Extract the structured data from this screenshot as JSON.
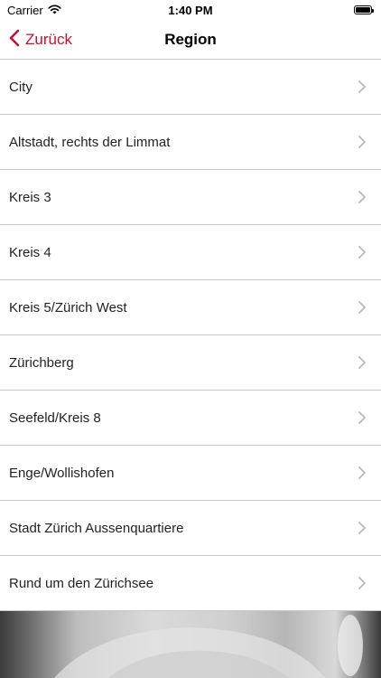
{
  "status_bar": {
    "carrier": "Carrier",
    "time": "1:40 PM",
    "icons": [
      "wifi-icon",
      "battery-icon"
    ]
  },
  "nav": {
    "back_label": "Zurück",
    "title": "Region",
    "accent_color": "#c8102e"
  },
  "regions": [
    {
      "label": "City"
    },
    {
      "label": "Altstadt, rechts der Limmat"
    },
    {
      "label": "Kreis 3"
    },
    {
      "label": "Kreis 4"
    },
    {
      "label": "Kreis 5/Zürich West"
    },
    {
      "label": "Zürichberg"
    },
    {
      "label": "Seefeld/Kreis 8"
    },
    {
      "label": "Enge/Wollishofen"
    },
    {
      "label": "Stadt Zürich Aussenquartiere"
    },
    {
      "label": "Rund um den Zürichsee"
    }
  ]
}
